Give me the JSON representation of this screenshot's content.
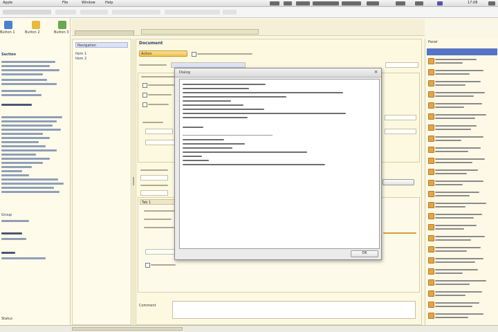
{
  "menubar": {
    "items": [
      {
        "label": "Apple"
      },
      {
        "label": "File"
      },
      {
        "label": "Window"
      },
      {
        "label": "Help"
      }
    ],
    "clock": "17:08"
  },
  "left_panel": {
    "toolbar": [
      {
        "label": "Button 1"
      },
      {
        "label": "Button 2"
      },
      {
        "label": "Button 3"
      }
    ],
    "heading": "Section",
    "subheading": "Group",
    "footer": "Status"
  },
  "nav_panel": {
    "title": "Navigation",
    "items": [
      {
        "label": "Item 1"
      },
      {
        "label": "Item 2"
      }
    ]
  },
  "form": {
    "title": "Document",
    "action_button": "Action",
    "tab": "Tab 1",
    "comment_label": "Comment"
  },
  "right_panel": {
    "title": "Panel"
  },
  "dialog": {
    "title": "Dialog",
    "ok_label": "OK"
  }
}
